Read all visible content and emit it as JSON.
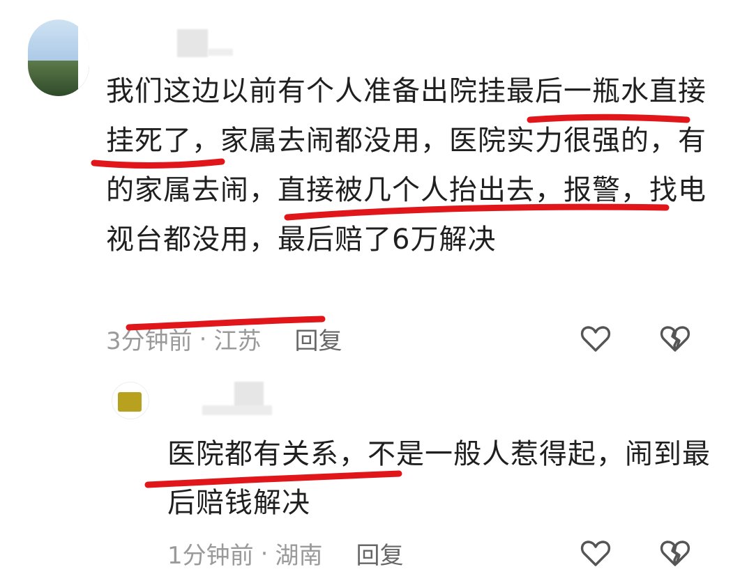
{
  "comments": [
    {
      "text": "我们这边以前有个人准备出院挂最后一瓶水直接挂死了，家属去闹都没用，医院实力很强的，有的家属去闹，直接被几个人抬出去，报警，找电视台都没用，最后赔了6万解决",
      "time": "3分钟前",
      "location": "江苏",
      "reply_label": "回复"
    },
    {
      "text": "医院都有关系，不是一般人惹得起，闹到最后赔钱解决",
      "time": "1分钟前",
      "location": "湖南",
      "reply_label": "回复"
    }
  ],
  "meta_separator": "·",
  "icons": {
    "like": "heart-outline-icon",
    "dislike": "broken-heart-icon"
  },
  "colors": {
    "annotation_underline": "#e0161b",
    "meta_text": "#9a9a9a"
  }
}
